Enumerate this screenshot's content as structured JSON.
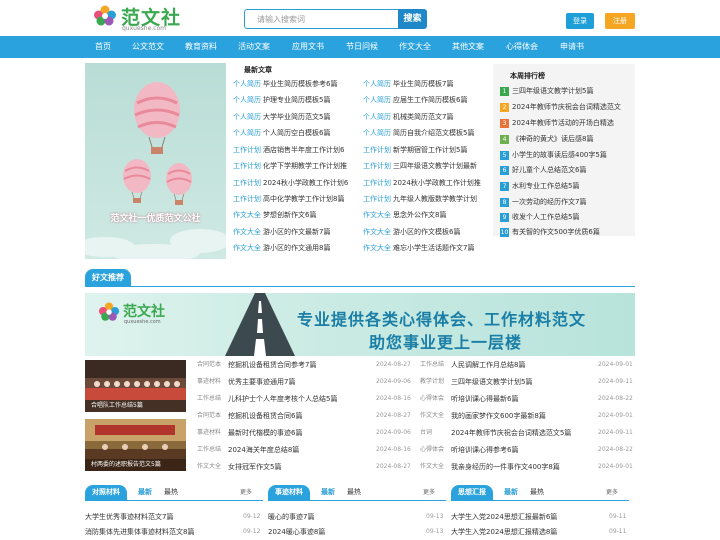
{
  "header": {
    "logo_name": "范文社",
    "logo_domain": "quxueshe.com",
    "search_placeholder": "请输入搜索词",
    "search_button": "搜索",
    "login": "登录",
    "register": "注册"
  },
  "nav": [
    "首页",
    "公文范文",
    "教育资料",
    "活动文案",
    "应用文书",
    "节日问候",
    "作文大全",
    "其他文案",
    "心得体会",
    "申请书"
  ],
  "hero": {
    "caption": "范文社一优质范文公社"
  },
  "latest": {
    "title": "最新文章",
    "left": [
      {
        "cat": "个人简历",
        "title": "毕业生简历模板参考6篇"
      },
      {
        "cat": "个人简历",
        "title": "护理专业简历模板5篇"
      },
      {
        "cat": "个人简历",
        "title": "大学毕业简历范文5篇"
      },
      {
        "cat": "个人简历",
        "title": "个人简历空白模板6篇"
      },
      {
        "cat": "工作计划",
        "title": "酒店销售半年度工作计划6"
      },
      {
        "cat": "工作计划",
        "title": "化学下学期教学工作计划推"
      },
      {
        "cat": "工作计划",
        "title": "2024秋小学政教工作计划6"
      },
      {
        "cat": "工作计划",
        "title": "高中化学教学工作计划8篇"
      },
      {
        "cat": "作文大全",
        "title": "梦想创新作文6篇"
      },
      {
        "cat": "作文大全",
        "title": "游小区的作文最新7篇"
      },
      {
        "cat": "作文大全",
        "title": "游小区的作文通用8篇"
      }
    ],
    "right": [
      {
        "cat": "个人简历",
        "title": "毕业生简历模板7篇"
      },
      {
        "cat": "个人简历",
        "title": "应届生工作简历模板6篇"
      },
      {
        "cat": "个人简历",
        "title": "机械类简历范文7篇"
      },
      {
        "cat": "个人简历",
        "title": "简历自我介绍范文模板5篇"
      },
      {
        "cat": "工作计划",
        "title": "新学期宿管工作计划5篇"
      },
      {
        "cat": "工作计划",
        "title": "三四年级语文教学计划最新"
      },
      {
        "cat": "工作计划",
        "title": "2024秋小学政教工作计划推"
      },
      {
        "cat": "工作计划",
        "title": "九年级人教版数学教学计划"
      },
      {
        "cat": "作文大全",
        "title": "思念外公作文8篇"
      },
      {
        "cat": "作文大全",
        "title": "游小区的作文模板6篇"
      },
      {
        "cat": "作文大全",
        "title": "难忘小学生活话题作文7篇"
      }
    ]
  },
  "ranking": {
    "title": "本周排行榜",
    "items": [
      {
        "num": "1",
        "color": "#3aa84f",
        "title": "三四年级语文教学计划5篇"
      },
      {
        "num": "2",
        "color": "#f5a623",
        "title": "2024年教师节庆祝会台词精选范文"
      },
      {
        "num": "3",
        "color": "#e8743b",
        "title": "2024年教师节活动的开场白精选"
      },
      {
        "num": "4",
        "color": "#6fb04e",
        "title": "《神奇的黄犬》读后感8篇"
      },
      {
        "num": "5",
        "color": "#2a9fd6",
        "title": "小学生的故事读后感400字5篇"
      },
      {
        "num": "6",
        "color": "#2a9fd6",
        "title": "好儿童个人总结范文6篇"
      },
      {
        "num": "7",
        "color": "#2a9fd6",
        "title": "水利专业工作总结5篇"
      },
      {
        "num": "8",
        "color": "#2a9fd6",
        "title": "一次劳动的经历作文7篇"
      },
      {
        "num": "9",
        "color": "#2a9fd6",
        "title": "收发个人工作总结5篇"
      },
      {
        "num": "10",
        "color": "#2a9fd6",
        "title": "有关智的作文500字优质6篇"
      }
    ]
  },
  "recommend": {
    "tag": "好文推荐",
    "banner_logo": "范文社",
    "banner_domain": "quxueshe.com",
    "banner_line1": "专业提供各类心得体会、工作材料范文",
    "banner_line2": "助您事业更上一层楼",
    "thumb1_caption": "合唱队工作总结5篇",
    "thumb2_caption": "村两委的述职报告范文5篇",
    "left_rows": [
      {
        "cat": "合同范本",
        "title": "挖掘机设备租赁合同参考7篇",
        "date": "2024-08-27"
      },
      {
        "cat": "事迹材料",
        "title": "优秀主要事迹通用7篇",
        "date": "2024-09-06"
      },
      {
        "cat": "工作总结",
        "title": "儿科护士个人年度考核个人总结5篇",
        "date": "2024-08-16"
      },
      {
        "cat": "合同范本",
        "title": "挖掘机设备租赁合同6篇",
        "date": "2024-08-27"
      },
      {
        "cat": "事迹材料",
        "title": "最新时代楷模的事迹6篇",
        "date": "2024-09-06"
      },
      {
        "cat": "工作总结",
        "title": "2024海关年度总结8篇",
        "date": "2024-08-16"
      },
      {
        "cat": "作文大全",
        "title": "女排冠军作文5篇",
        "date": "2024-08-27"
      }
    ],
    "right_rows": [
      {
        "cat": "工作总结",
        "title": "人民调解工作月总结8篇",
        "date": "2024-09-01"
      },
      {
        "cat": "教学计划",
        "title": "三四年级语文教学计划5篇",
        "date": "2024-09-11"
      },
      {
        "cat": "心得体会",
        "title": "听培训课心得最新6篇",
        "date": "2024-08-22"
      },
      {
        "cat": "作文大全",
        "title": "我的画家梦作文600字最新8篇",
        "date": "2024-09-01"
      },
      {
        "cat": "台词",
        "title": "2024年教师节庆祝会台词精选范文5篇",
        "date": "2024-09-11"
      },
      {
        "cat": "心得体会",
        "title": "听培训课心得参考6篇",
        "date": "2024-08-22"
      },
      {
        "cat": "作文大全",
        "title": "我亲身经历的一件事作文400字8篇",
        "date": "2024-09-01"
      }
    ]
  },
  "bottom": [
    {
      "tag": "对照材料",
      "tab_new": "最新",
      "tab_hot": "最热",
      "more": "更多",
      "items": [
        {
          "title": "大学生优秀事迹材料范文7篇",
          "date": "09-12"
        },
        {
          "title": "消防集体先进集体事迹材料范文8篇",
          "date": "09-12"
        }
      ]
    },
    {
      "tag": "事迹材料",
      "tab_new": "最新",
      "tab_hot": "最热",
      "more": "更多",
      "items": [
        {
          "title": "暖心的事迹7篇",
          "date": "09-13"
        },
        {
          "title": "2024暖心事迹8篇",
          "date": "09-13"
        }
      ]
    },
    {
      "tag": "思想汇报",
      "tab_new": "最新",
      "tab_hot": "最热",
      "more": "更多",
      "items": [
        {
          "title": "大学生入党2024思想汇报最新6篇",
          "date": "09-11"
        },
        {
          "title": "大学生入党2024思想汇报精选8篇",
          "date": "09-11"
        }
      ]
    }
  ]
}
